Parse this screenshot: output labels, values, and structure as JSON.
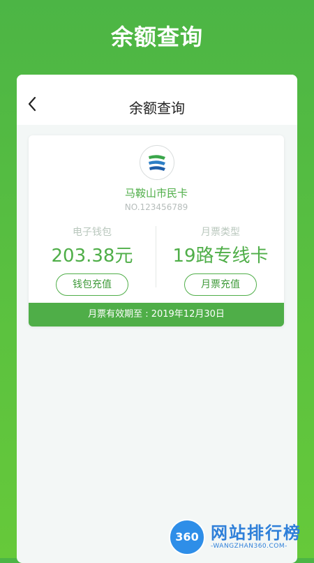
{
  "header": {
    "title": "余额查询"
  },
  "navbar": {
    "title": "余额查询"
  },
  "card": {
    "name": "马鞍山市民卡",
    "number": "NO.123456789",
    "wallet": {
      "label": "电子钱包",
      "value": "203.38元",
      "button": "钱包充值"
    },
    "monthly": {
      "label": "月票类型",
      "value": "19路专线卡",
      "button": "月票充值"
    },
    "validity": "月票有效期至 : 2019年12月30日"
  },
  "watermark": {
    "text": "网站排行榜",
    "badge": "360",
    "url": "-WANGZHAN360.COM-"
  },
  "colors": {
    "brand_green": "#4fae48",
    "background_green": "#5cc23f"
  },
  "icons": {
    "back": "chevron-left-icon",
    "logo": "citizen-card-logo-icon"
  }
}
